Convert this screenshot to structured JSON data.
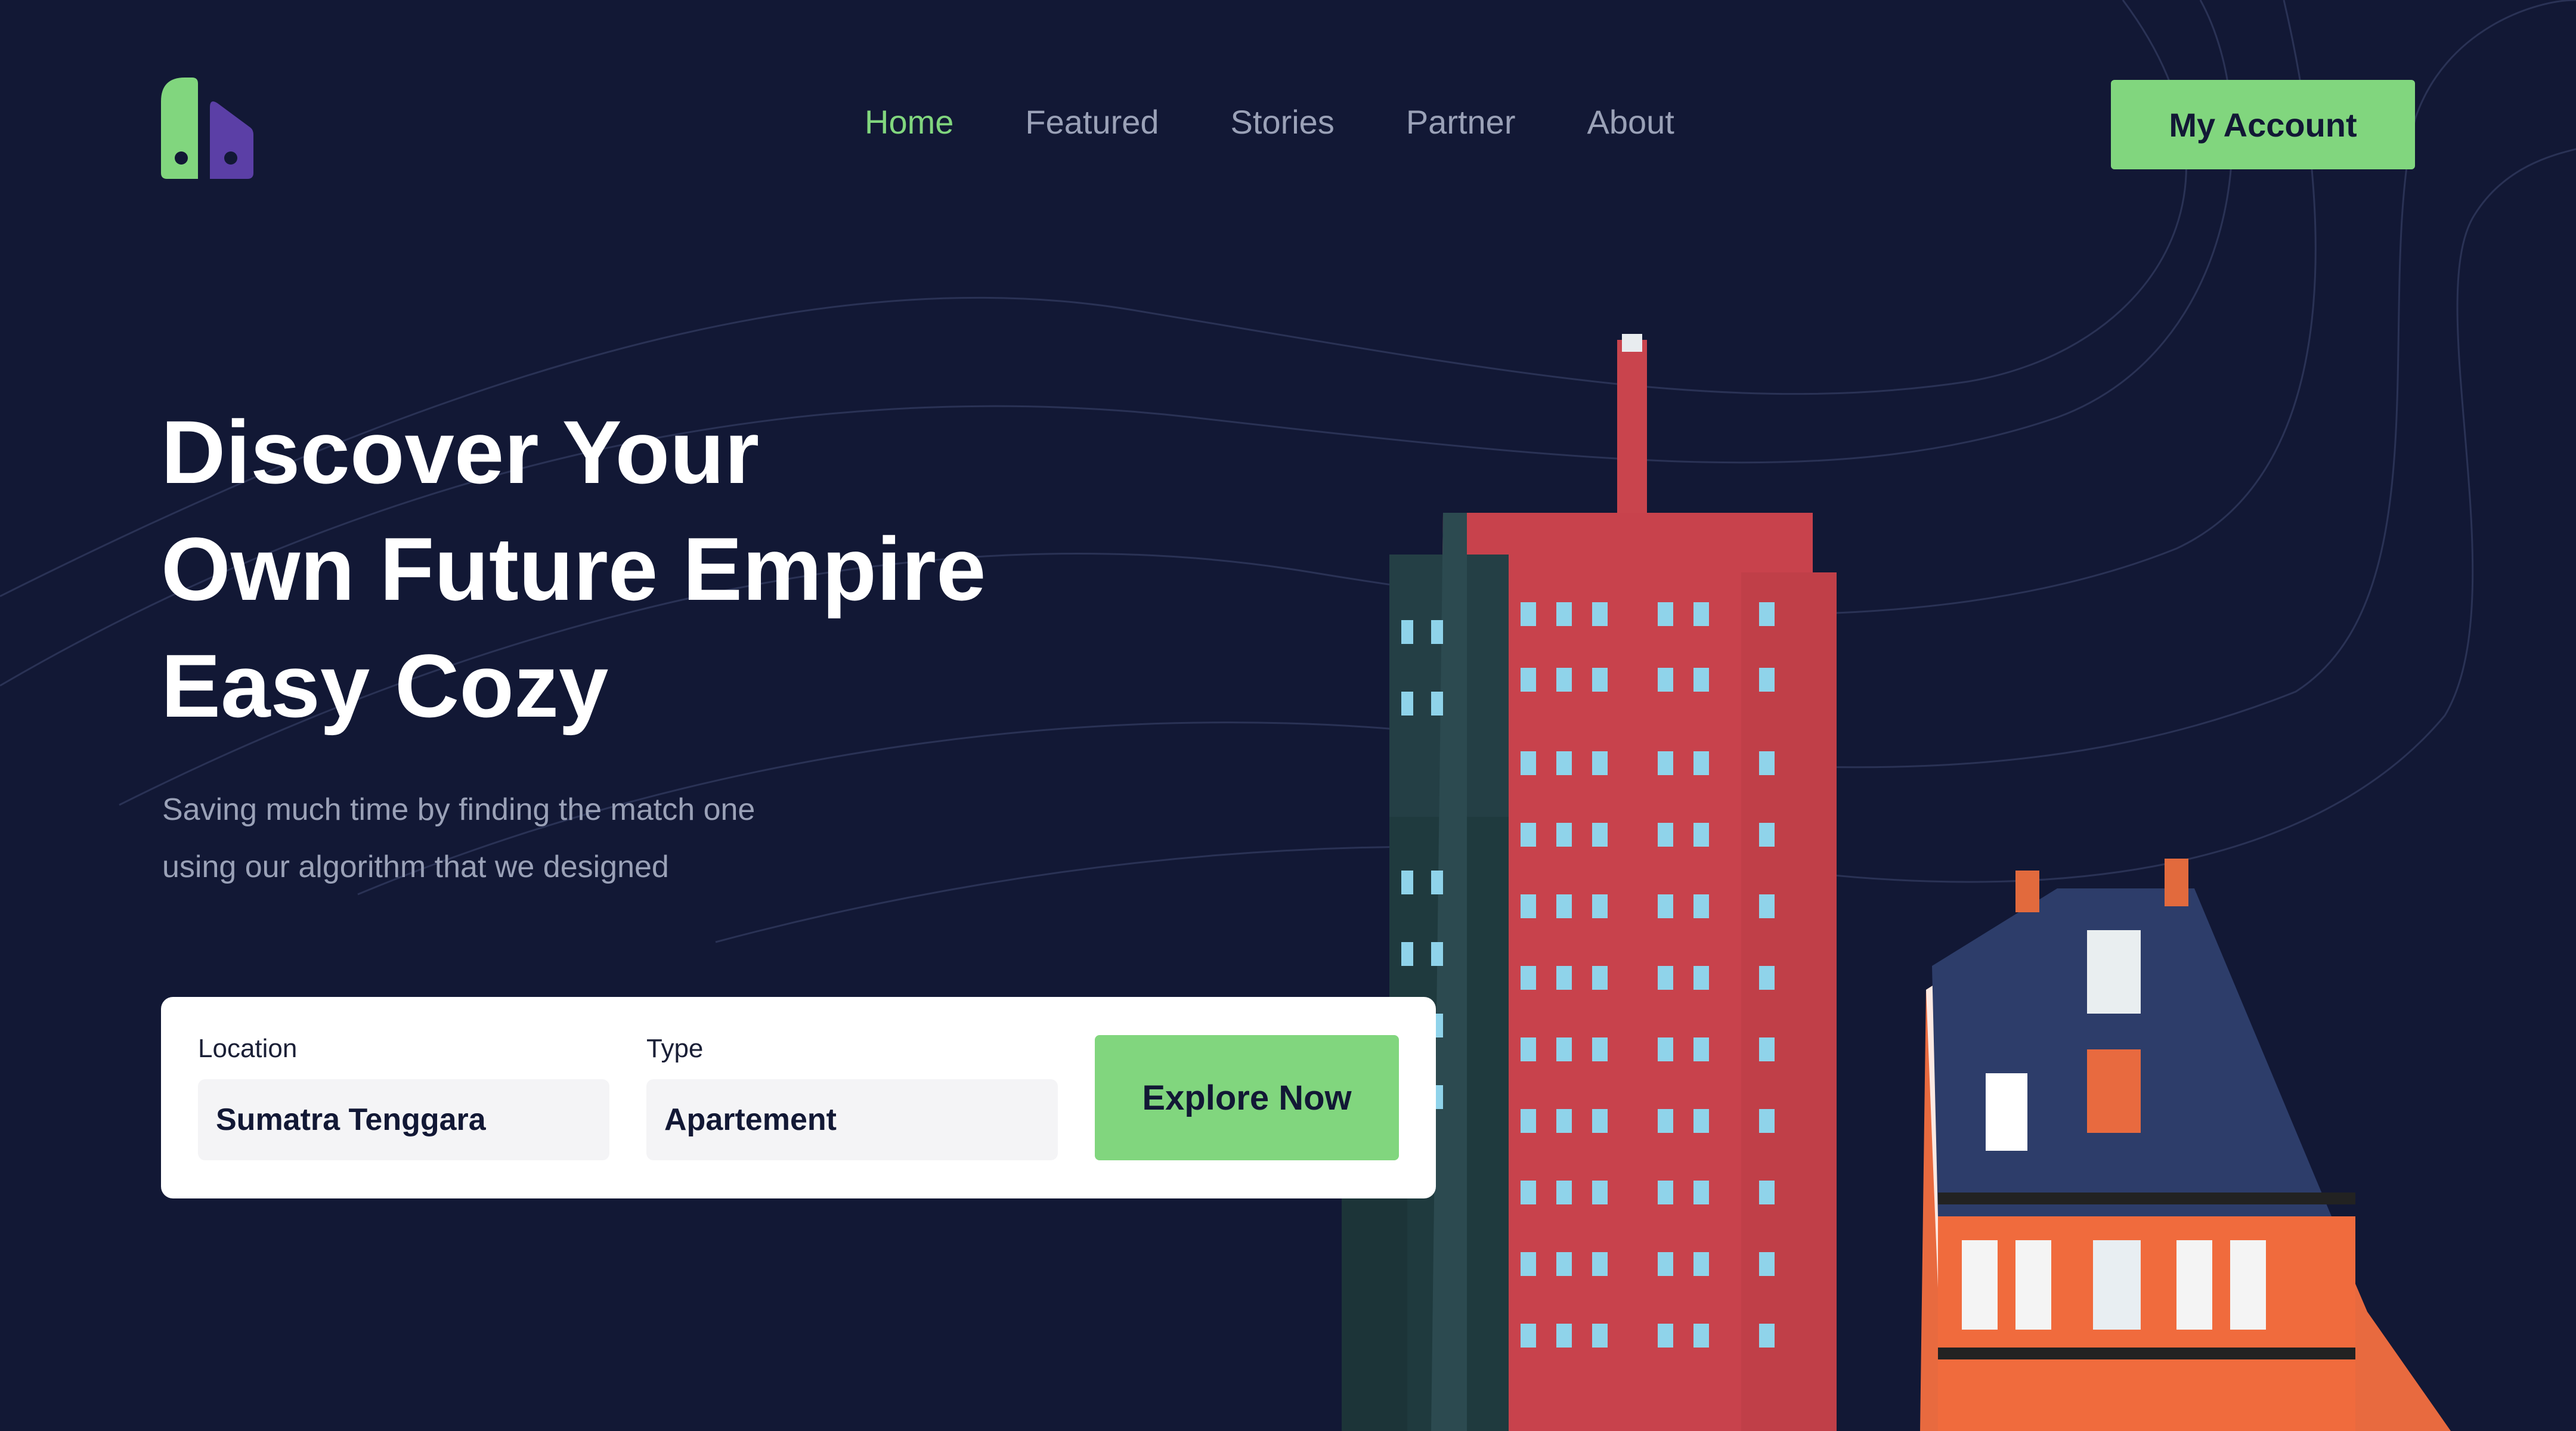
{
  "brand": {
    "logo_icon": "building-logo-icon"
  },
  "nav": {
    "items": [
      {
        "label": "Home",
        "active": true
      },
      {
        "label": "Featured",
        "active": false
      },
      {
        "label": "Stories",
        "active": false
      },
      {
        "label": "Partner",
        "active": false
      },
      {
        "label": "About",
        "active": false
      }
    ],
    "account_label": "My Account"
  },
  "hero": {
    "title_lines": [
      "Discover Your",
      "Own Future Empire",
      "Easy Cozy"
    ],
    "subtitle_lines": [
      "Saving much time by finding the match one",
      "using our algorithm that we designed"
    ]
  },
  "search": {
    "location_label": "Location",
    "location_value": "Sumatra Tenggara",
    "type_label": "Type",
    "type_value": "Apartement",
    "explore_label": "Explore Now"
  },
  "colors": {
    "background": "#121835",
    "accent": "#81d67e",
    "logo_purple": "#5b3fa6",
    "muted_text": "#9aa1b7"
  }
}
